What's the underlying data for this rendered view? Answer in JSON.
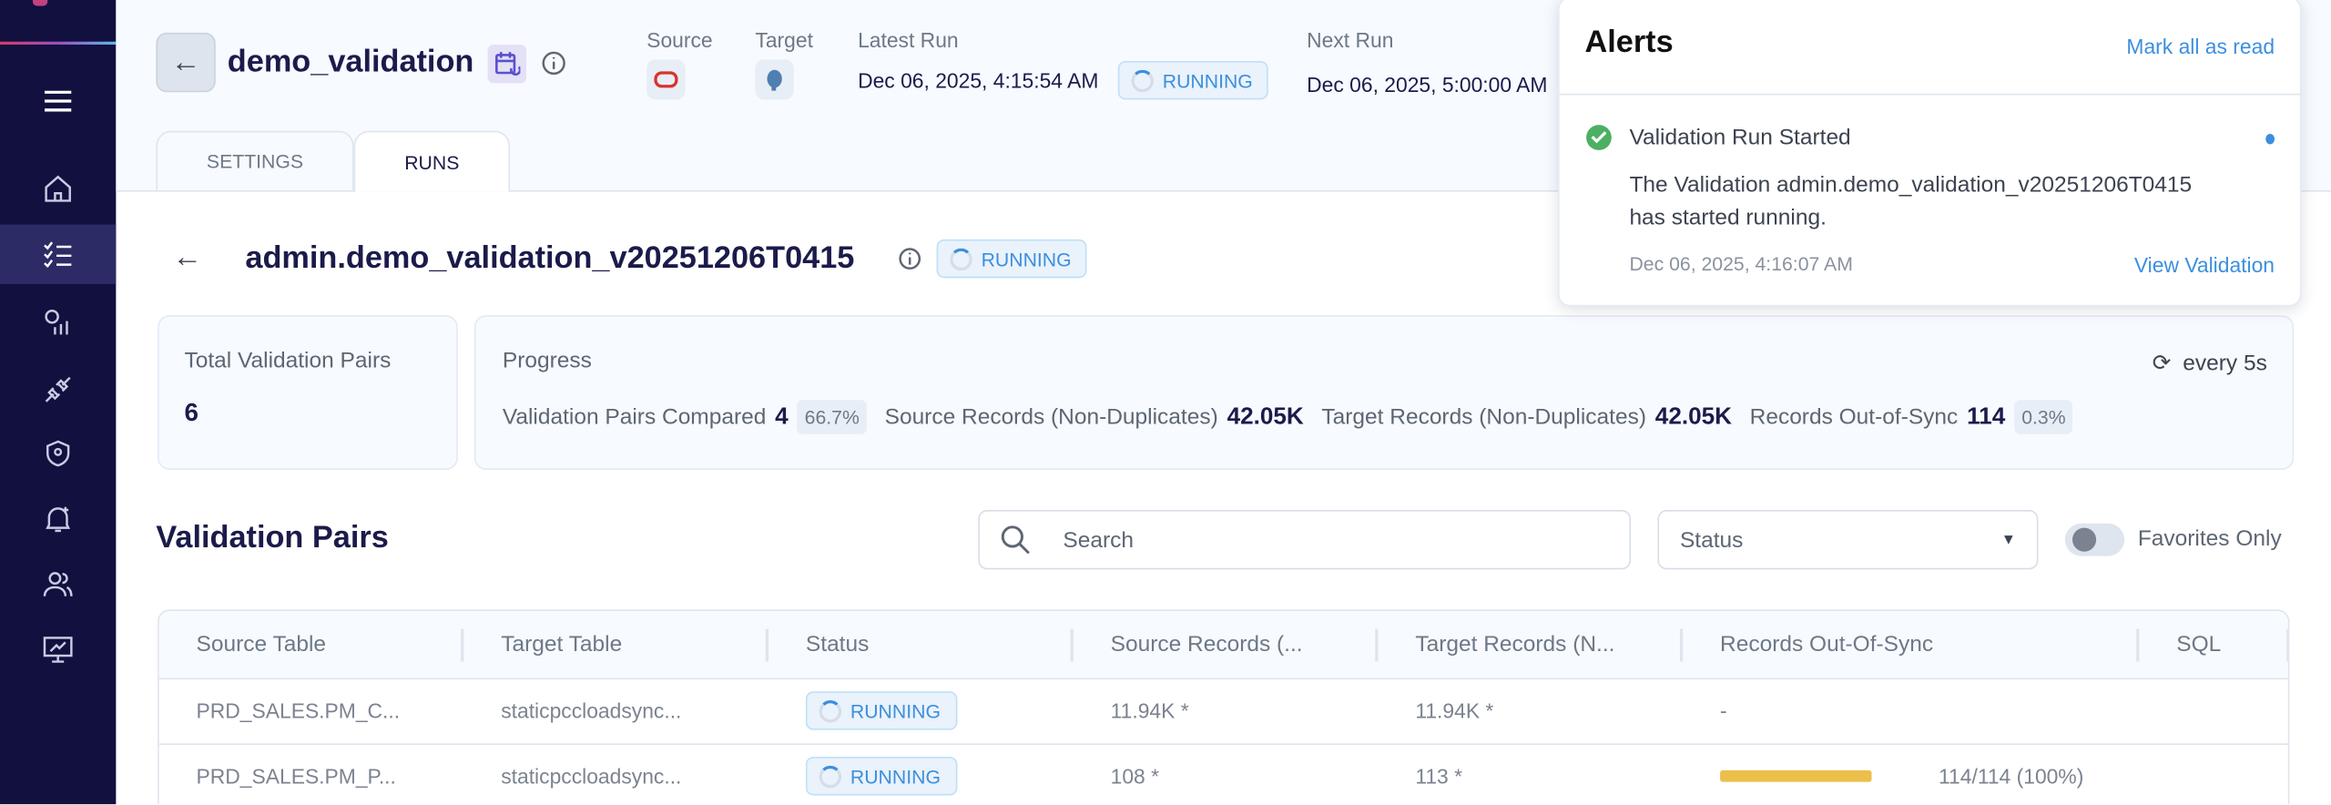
{
  "header": {
    "title": "demo_validation",
    "source_label": "Source",
    "target_label": "Target",
    "latest_run_label": "Latest Run",
    "latest_run_value": "Dec 06, 2025, 4:15:54 AM",
    "latest_run_status": "RUNNING",
    "next_run_label": "Next Run",
    "next_run_value": "Dec 06, 2025, 5:00:00 AM"
  },
  "tabs": [
    {
      "label": "SETTINGS"
    },
    {
      "label": "RUNS"
    }
  ],
  "run": {
    "title": "admin.demo_validation_v20251206T0415",
    "status": "RUNNING"
  },
  "summary": {
    "total_label": "Total Validation Pairs",
    "total_value": "6",
    "progress_label": "Progress",
    "refresh_label": "every 5s",
    "compared_label": "Validation Pairs Compared",
    "compared_value": "4",
    "compared_pct": "66.7%",
    "source_label": "Source Records (Non-Duplicates)",
    "source_value": "42.05K",
    "target_label": "Target Records (Non-Duplicates)",
    "target_value": "42.05K",
    "oos_label": "Records Out-of-Sync",
    "oos_value": "114",
    "oos_pct": "0.3%"
  },
  "pairs": {
    "title": "Validation Pairs",
    "search_placeholder": "Search",
    "status_placeholder": "Status",
    "favorites_label": "Favorites Only",
    "columns": [
      "Source Table",
      "Target Table",
      "Status",
      "Source Records (...",
      "Target Records (N...",
      "Records Out-Of-Sync",
      "SQL"
    ],
    "rows": [
      {
        "source": "PRD_SALES.PM_C...",
        "target": "staticpccloadsync...",
        "status": "RUNNING",
        "source_records": "11.94K *",
        "target_records": "11.94K *",
        "oos": "-",
        "oos_fraction": null
      },
      {
        "source": "PRD_SALES.PM_P...",
        "target": "staticpccloadsync...",
        "status": "RUNNING",
        "source_records": "108 *",
        "target_records": "113 *",
        "oos": "114/114 (100%)",
        "oos_fraction": 1.0
      }
    ]
  },
  "alerts": {
    "title": "Alerts",
    "mark_all": "Mark all as read",
    "items": [
      {
        "title": "Validation Run Started",
        "body_line1": "The Validation admin.demo_validation_v20251206T0415",
        "body_line2": "has started running.",
        "time": "Dec 06, 2025, 4:16:07 AM",
        "action": "View Validation"
      }
    ]
  },
  "colors": {
    "sidebar": "#11103f",
    "accent": "#3b8fde",
    "warning_bar": "#ecbf4b",
    "success": "#4caf63"
  }
}
